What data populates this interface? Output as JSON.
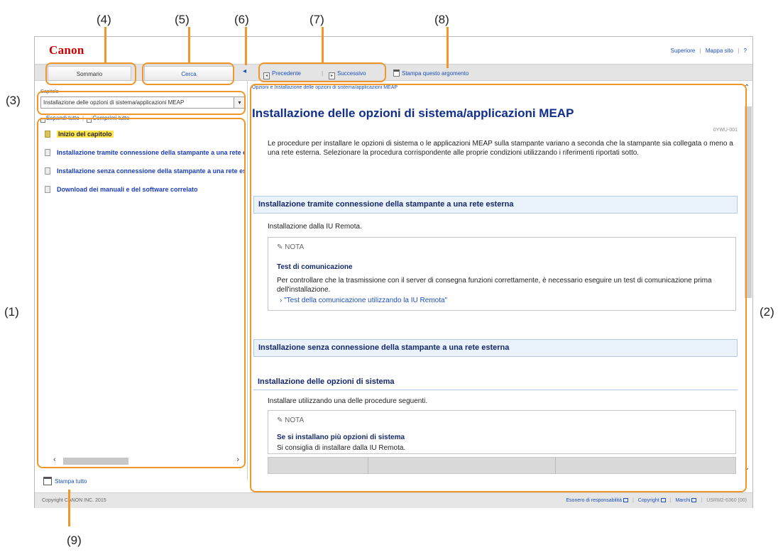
{
  "callouts": {
    "c1": "(1)",
    "c2": "(2)",
    "c3": "(3)",
    "c4": "(4)",
    "c5": "(5)",
    "c6": "(6)",
    "c7": "(7)",
    "c8": "(8)",
    "c9": "(9)"
  },
  "header": {
    "logo": "Canon",
    "link_top": "Superiore",
    "link_sitemap": "Mappa sito",
    "link_help": "?",
    "sep": "|"
  },
  "tabs": {
    "contents": "Sommario",
    "search": "Cerca",
    "collapse_arrow": "◂"
  },
  "nav": {
    "prev": "Precedente",
    "next": "Successivo",
    "print_topic": "Stampa questo argomento",
    "sep": "|"
  },
  "sidebar": {
    "chapter_label": "Capitolo",
    "chapter_value": "Installazione delle opzioni di sistema/applicazioni MEAP",
    "expand_all": "Espandi tutto",
    "collapse_all": "Comprimi tutto",
    "sep": "|",
    "items": [
      {
        "label": "Inizio del capitolo"
      },
      {
        "label": "Installazione tramite connessione della stampante a una rete esterna"
      },
      {
        "label": "Installazione senza connessione della stampante a una rete esterna"
      },
      {
        "label": "Download dei manuali e del software correlato"
      }
    ],
    "print_all": "Stampa tutto"
  },
  "content": {
    "breadcrumb": "Opzioni e Installazione delle opzioni di sistema/applicazioni MEAP",
    "title": "Installazione delle opzioni di sistema/applicazioni MEAP",
    "doc_id": "0YWU-001",
    "intro": "Le procedure per installare le opzioni di sistema o le applicazioni MEAP sulla stampante variano a seconda che la stampante sia collegata o meno a una rete esterna. Selezionare la procedura corrispondente alle proprie condizioni utilizzando i riferimenti riportati sotto.",
    "section1": "Installazione tramite connessione della stampante a una rete esterna",
    "section1_text": "Installazione dalla IU Remota.",
    "note_label": "NOTA",
    "note1_title": "Test di comunicazione",
    "note1_body": "Per controllare che la trasmissione con il server di consegna funzioni correttamente, è necessario eseguire un test di comunicazione prima dell'installazione.",
    "note1_link": "\"Test della comunicazione utilizzando la IU Remota\"",
    "section2": "Installazione senza connessione della stampante a una rete esterna",
    "sub_heading": "Installazione delle opzioni di sistema",
    "sub_text": "Installare utilizzando una delle procedure seguenti.",
    "note2_title": "Se si installano più opzioni di sistema",
    "note2_body": "Si consiglia di installare dalla IU Remota."
  },
  "footer": {
    "copyright": "Copyright CANON INC. 2015",
    "disclaimer": "Esonero di responsabilità",
    "copyright_link": "Copyright",
    "trademarks": "Marchi",
    "code": "USRM2-6360 (00)",
    "sep": "|"
  },
  "colors": {
    "callout_border": "#f0962a",
    "logo": "#cc0000",
    "link": "#1a4fbd",
    "title": "#102f8c",
    "highlight": "#ffe64d"
  }
}
